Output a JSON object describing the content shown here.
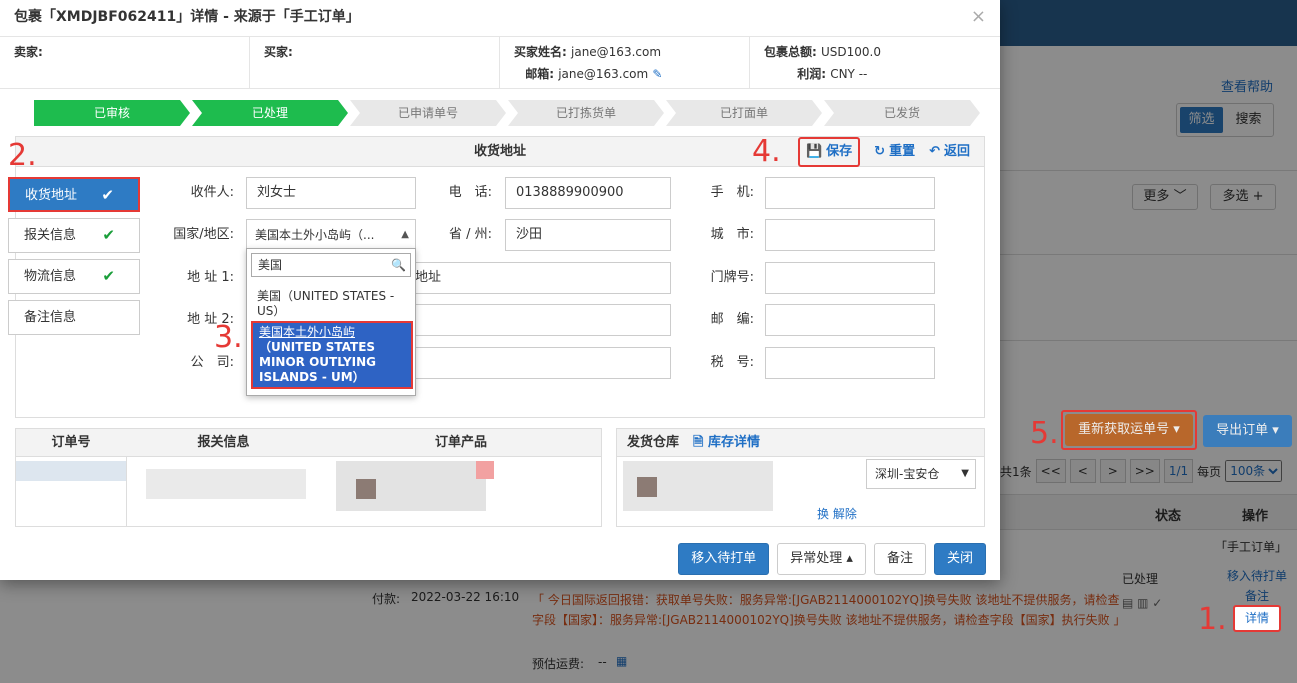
{
  "modal": {
    "title": "包裹「XMDJBF062411」详情 - 来源于「手工订单」",
    "close": "×",
    "info": {
      "seller_label": "卖家:",
      "buyer_label": "买家:",
      "buyer_name_label": "买家姓名:",
      "buyer_name": "jane@163.com",
      "email_label": "邮箱:",
      "email": "jane@163.com",
      "total_label": "包裹总额:",
      "total": "USD100.0",
      "profit_label": "利润:",
      "profit": "CNY --"
    },
    "steps": [
      {
        "label": "已审核",
        "done": true
      },
      {
        "label": "已处理",
        "done": true
      },
      {
        "label": "已申请单号",
        "done": false
      },
      {
        "label": "已打拣货单",
        "done": false
      },
      {
        "label": "已打面单",
        "done": false
      },
      {
        "label": "已发货",
        "done": false
      }
    ],
    "address": {
      "title": "收货地址",
      "save": "保存",
      "reset": "重置",
      "back": "返回",
      "fields": {
        "recipient_label": "收件人:",
        "recipient": "刘女士",
        "phone_label": "电　话:",
        "phone": "0138889900900",
        "mobile_label": "手　机:",
        "mobile": "",
        "country_label": "国家/地区:",
        "country": "美国本土外小岛屿（...",
        "province_label": "省 / 州:",
        "province": "沙田",
        "city_label": "城　市:",
        "city": "",
        "addr1_label": "地 址 1:",
        "addr1": "地址",
        "door_label": "门牌号:",
        "door": "",
        "addr2_label": "地 址 2:",
        "addr2": "",
        "zip_label": "邮　编:",
        "zip": "",
        "company_label": "公　司:",
        "company": "",
        "tax_label": "税　号:",
        "tax": ""
      },
      "dropdown": {
        "search": "美国",
        "options": [
          {
            "line1": "美国（UNITED STATES -",
            "line2": "US）"
          },
          {
            "line1": "美国本土外小岛屿",
            "line2": "（UNITED STATES",
            "line3": "MINOR OUTLYING",
            "line4": "ISLANDS - UM）"
          }
        ]
      }
    },
    "tabs": [
      "收货地址",
      "报关信息",
      "物流信息",
      "备注信息"
    ],
    "order_table": {
      "headers": [
        "订单号",
        "报关信息",
        "订单产品"
      ]
    },
    "warehouse": {
      "title": "发货仓库",
      "link": "库存详情",
      "selected": "深圳-宝安仓",
      "unbind_prefix": "换",
      "unbind": "解除"
    },
    "footer": [
      "移入待打单",
      "异常处理 ▴",
      "备注",
      "关闭"
    ]
  },
  "annotations": [
    "1.",
    "2.",
    "3.",
    "4.",
    "5."
  ],
  "background": {
    "help": "查看帮助",
    "filter": "筛选",
    "search": "搜索",
    "more": "更多",
    "multi": "多选 +",
    "regen": "重新获取运单号 ▾",
    "export": "导出订单 ▾",
    "pager": {
      "count": "共1条",
      "first": "<<",
      "prev": "<",
      "next": ">",
      "last": ">>",
      "page": "1/1",
      "per_page_label": "每页",
      "per_page": "100条"
    },
    "table_status": "状态",
    "table_ops": "操作",
    "source": "「手工订单」",
    "status_value": "已处理",
    "paid_label": "付款:",
    "paid_time": "2022-03-22 16:10",
    "error": "「 今日国际返回报错：获取单号失败：服务异常:[JGAB2114000102YQ]换号失败 该地址不提供服务，请检查字段【国家】：服务异常:[JGAB2114000102YQ]换号失败 该地址不提供服务，请检查字段【国家】执行失败 」",
    "freight_label": "预估运费:",
    "freight": "--",
    "op_move": "移入待打单",
    "op_note": "备注",
    "op_detail": "详情"
  }
}
